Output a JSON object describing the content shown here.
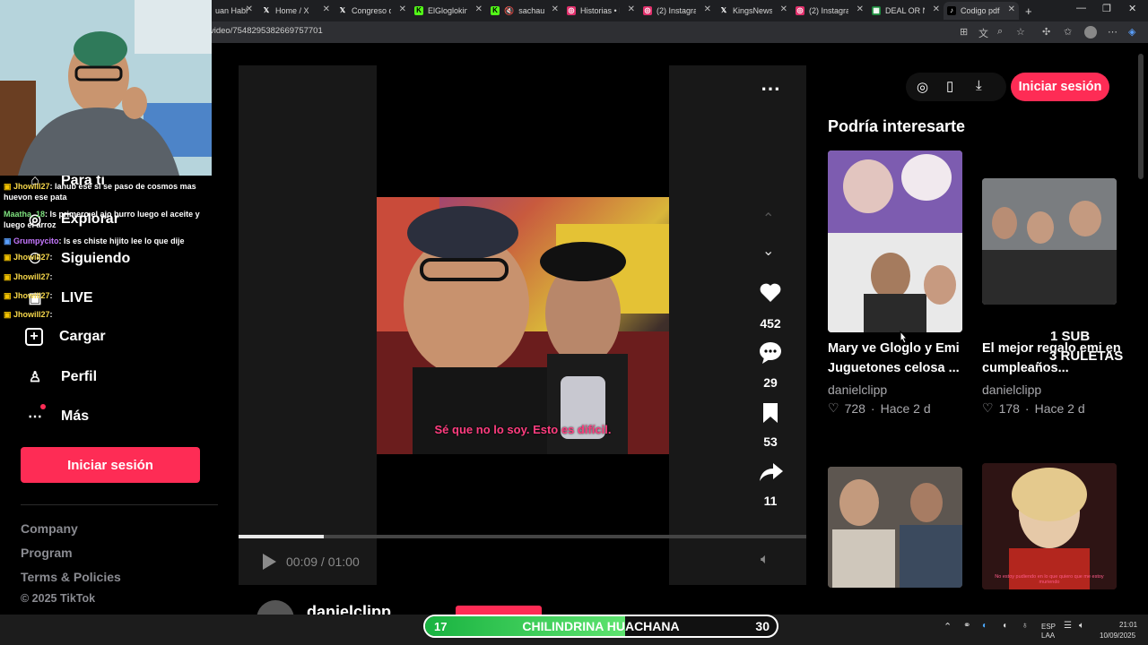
{
  "browser": {
    "tabs": [
      {
        "label": "uan Habl",
        "icon": "tab-favicon",
        "color": "#e8e8e8"
      },
      {
        "label": "Home / X",
        "icon": "x-logo-icon",
        "color": "#000000"
      },
      {
        "label": "Congreso d",
        "icon": "x-logo-icon",
        "color": "#000000"
      },
      {
        "label": "ElGlogloking",
        "icon": "kick-icon",
        "color": "#53fc18"
      },
      {
        "label": "sachau",
        "icon": "kick-icon",
        "color": "#53fc18"
      },
      {
        "label": "Historias • I",
        "icon": "instagram-icon",
        "color": "#e1306c"
      },
      {
        "label": "(2) Instagram",
        "icon": "instagram-icon",
        "color": "#e1306c"
      },
      {
        "label": "KingsNews",
        "icon": "x-logo-icon",
        "color": "#000000"
      },
      {
        "label": "(2) Instagram",
        "icon": "instagram-icon",
        "color": "#e1306c"
      },
      {
        "label": "DEAL OR NO",
        "icon": "sheet-icon",
        "color": "#1b8a3c"
      },
      {
        "label": "Codigo pdf",
        "icon": "tiktok-icon",
        "color": "#000000"
      }
    ],
    "url": "video/7548295382669757701"
  },
  "sidebar": {
    "nav": [
      {
        "label": "Para ti",
        "icon": "home-icon"
      },
      {
        "label": "Explorar",
        "icon": "compass-icon"
      },
      {
        "label": "Siguiendo",
        "icon": "following-icon"
      },
      {
        "label": "LIVE",
        "icon": "live-icon"
      },
      {
        "label": "Cargar",
        "icon": "upload-icon"
      },
      {
        "label": "Perfil",
        "icon": "profile-icon"
      },
      {
        "label": "Más",
        "icon": "more-icon"
      }
    ],
    "login_label": "Iniciar sesión",
    "footer": [
      "Company",
      "Program",
      "Terms & Policies",
      "© 2025 TikTok"
    ]
  },
  "chat": [
    {
      "user": "Jhowill27",
      "text": ": lanub ese si se paso de cosmos mas"
    },
    {
      "user": "",
      "text": "huevon ese pata"
    },
    {
      "user": "Maatha_18",
      "text": ": Is primero el ajo burro luego el aceite y"
    },
    {
      "user": "",
      "text": "luego el arroz"
    },
    {
      "user": "Grumpycito",
      "text": ": Is es chiste hijito lee lo que dije"
    },
    {
      "user": "Jhowill27",
      "text": ":"
    },
    {
      "user": "Jhowill27",
      "text": ":"
    },
    {
      "user": "Jhowill27",
      "text": ":"
    },
    {
      "user": "Jhowill27",
      "text": ":"
    }
  ],
  "video": {
    "subtitle": "Sé que no lo soy. Esto es difícil.",
    "likes": "452",
    "comments": "29",
    "saves": "53",
    "shares": "11",
    "time": "00:09 / 01:00",
    "progress": 0.15,
    "author": "danielclipp"
  },
  "right": {
    "heading": "Podría interesarte",
    "top_login": "Iniciar sesión",
    "recs": [
      {
        "title": "Mary ve Gloglo y Emi Juguetones celosa ...",
        "author": "danielclipp",
        "likes": "728",
        "age": "Hace 2 d"
      },
      {
        "title": "El mejor regalo emi en cumpleaños...",
        "author": "danielclipp",
        "likes": "178",
        "age": "Hace 2 d"
      }
    ],
    "thumb4_caption": "No estoy pudiendo en lo que quiero que me estoy muriendo"
  },
  "overlay": {
    "line1": "1 SUB",
    "line2": "3 RULETAS"
  },
  "goal_bar": {
    "left": "17",
    "label": "CHILINDRINA HUACHANA",
    "right": "30",
    "fill": 0.57
  },
  "system": {
    "lang1": "ESP",
    "lang2": "LAA",
    "time": "21:01",
    "date": "10/09/2025"
  }
}
